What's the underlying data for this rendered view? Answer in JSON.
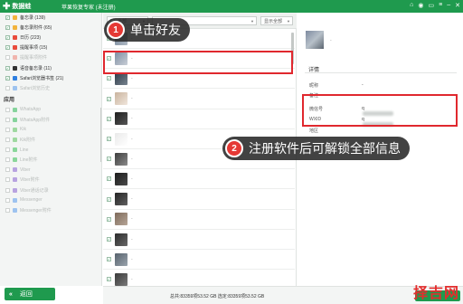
{
  "titlebar": {
    "logo_text": "数据蛙",
    "app_name": "苹果恢复专家 (未注册)"
  },
  "sidebar": {
    "items": [
      {
        "label": "备忘录 (139)",
        "checked": true,
        "dim": false,
        "icon_color": "#f2b33d",
        "icon": "notes-icon"
      },
      {
        "label": "备忘录附件 (65)",
        "checked": true,
        "dim": false,
        "icon_color": "#f2b33d",
        "icon": "notes-attachment-icon"
      },
      {
        "label": "日历 (223)",
        "checked": true,
        "dim": false,
        "icon_color": "#e94b3c",
        "icon": "calendar-icon"
      },
      {
        "label": "提醒事项 (15)",
        "checked": true,
        "dim": false,
        "icon_color": "#e94b3c",
        "icon": "reminders-icon"
      },
      {
        "label": "提醒事项附件",
        "checked": false,
        "dim": true,
        "icon_color": "#f0b5ad",
        "icon": "reminders-attachment-icon"
      },
      {
        "label": "语音备忘录 (11)",
        "checked": true,
        "dim": false,
        "icon_color": "#333333",
        "icon": "voice-memo-icon"
      },
      {
        "label": "Safari浏览器书签 (21)",
        "checked": true,
        "dim": false,
        "icon_color": "#2f7fe0",
        "icon": "safari-bookmark-icon"
      },
      {
        "label": "Safari浏览历史",
        "checked": false,
        "dim": true,
        "icon_color": "#9ec3ef",
        "icon": "safari-history-icon"
      }
    ],
    "section_label": "应用",
    "app_items": [
      {
        "label": "WhatsApp",
        "icon_color": "#86d39c",
        "icon": "whatsapp-icon"
      },
      {
        "label": "WhatsApp附件",
        "icon_color": "#86d39c",
        "icon": "whatsapp-attachment-icon"
      },
      {
        "label": "Kik",
        "icon_color": "#9fd8a0",
        "icon": "kik-icon"
      },
      {
        "label": "Kik附件",
        "icon_color": "#9fd8a0",
        "icon": "kik-attachment-icon"
      },
      {
        "label": "Line",
        "icon_color": "#8ad69a",
        "icon": "line-icon"
      },
      {
        "label": "Line附件",
        "icon_color": "#8ad69a",
        "icon": "line-attachment-icon"
      },
      {
        "label": "Viber",
        "icon_color": "#b8a3e0",
        "icon": "viber-icon"
      },
      {
        "label": "Viber附件",
        "icon_color": "#b8a3e0",
        "icon": "viber-attachment-icon"
      },
      {
        "label": "Viber通话记录",
        "icon_color": "#b8a3e0",
        "icon": "viber-call-log-icon"
      },
      {
        "label": "Messenger",
        "icon_color": "#9ec3ef",
        "icon": "messenger-icon"
      },
      {
        "label": "Messenger附件",
        "icon_color": "#9ec3ef",
        "icon": "messenger-attachment-icon"
      }
    ],
    "back_label": "返回"
  },
  "filter": {
    "type_value": "全部",
    "account_value": "",
    "show_value": "显示全部"
  },
  "contacts": [
    {
      "name": "-",
      "avatar_colors": [
        "#6a7d93",
        "#b1bac4"
      ]
    },
    {
      "name": "-",
      "avatar_colors": [
        "#7f8fa3",
        "#c8ced6"
      ]
    },
    {
      "name": "-",
      "avatar_colors": [
        "#2e3b48",
        "#77838f"
      ]
    },
    {
      "name": "-",
      "avatar_colors": [
        "#c9b39d",
        "#f0e6dc"
      ]
    },
    {
      "name": "-",
      "avatar_colors": [
        "#1f1f1f",
        "#555555"
      ]
    },
    {
      "name": "-",
      "avatar_colors": [
        "#e9e9e9",
        "#ffffff"
      ]
    },
    {
      "name": "-",
      "avatar_colors": [
        "#3d3d3d",
        "#8a8a8a"
      ]
    },
    {
      "name": "-",
      "avatar_colors": [
        "#1c1c1c",
        "#4a4a4a"
      ]
    },
    {
      "name": "-",
      "avatar_colors": [
        "#242424",
        "#606060"
      ]
    },
    {
      "name": "-",
      "avatar_colors": [
        "#7e6a5a",
        "#b6a597"
      ]
    },
    {
      "name": "-",
      "avatar_colors": [
        "#2b2b2b",
        "#686868"
      ]
    },
    {
      "name": "-",
      "avatar_colors": [
        "#56616c",
        "#9aa4ad"
      ]
    },
    {
      "name": "-",
      "avatar_colors": [
        "#3a3a3a",
        "#7a7a7a"
      ]
    }
  ],
  "detail": {
    "name": "-",
    "section_label": "详情",
    "fields": [
      {
        "key": "昵称",
        "value": "-",
        "masked": false
      },
      {
        "key": "备注",
        "value": "",
        "masked": false
      },
      {
        "key": "微信号",
        "value": "q",
        "masked": true
      },
      {
        "key": "WXID",
        "value": "q",
        "masked": true
      },
      {
        "key": "地区",
        "value": "",
        "masked": false
      }
    ]
  },
  "status": {
    "text": "总共:83359项53.52 GB 选定:83359项53.52 GB"
  },
  "callouts": [
    {
      "num": "1",
      "text": "单击好友"
    },
    {
      "num": "2",
      "text": "注册软件后可解锁全部信息"
    }
  ],
  "watermark": "择吉网",
  "colors": {
    "brand_green": "#1f9a4e",
    "highlight_red": "#e0282e",
    "callout_bg": "#282828"
  }
}
